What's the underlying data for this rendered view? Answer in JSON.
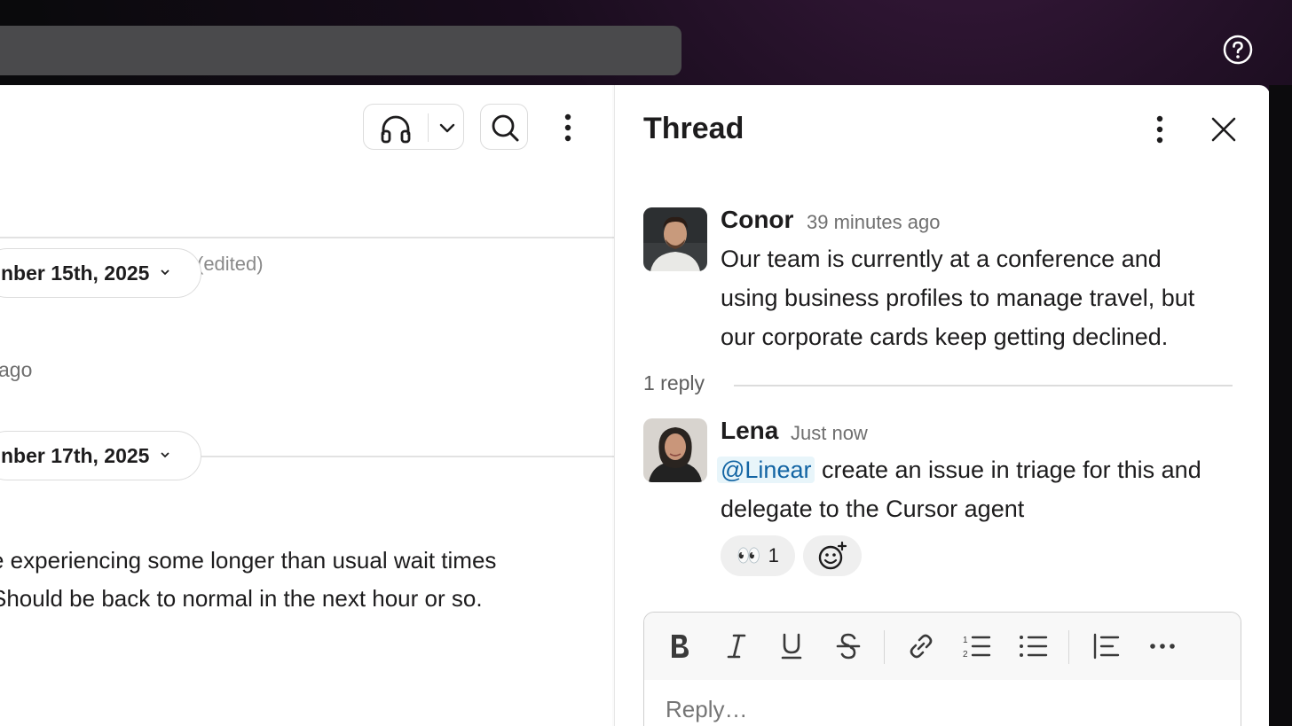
{
  "main": {
    "edited_label": "(edited)",
    "date_divider_1": "nber 15th, 2025",
    "date_divider_2": "nber 17th, 2025",
    "ago_label": "ago",
    "message_lines": [
      "e experiencing some longer than usual wait times",
      "Should be back to normal in the next hour or so."
    ]
  },
  "thread": {
    "title": "Thread",
    "parent": {
      "author": "Conor",
      "time": "39 minutes ago",
      "lines": [
        "Our team is currently at a conference and",
        "using business profiles to manage travel, but",
        "our corporate cards keep getting declined."
      ]
    },
    "reply_count": "1 reply",
    "reply": {
      "author": "Lena",
      "time": "Just now",
      "mention": "@Linear",
      "line1_rest": " create an issue in triage for this and",
      "line2": "delegate to the Cursor agent",
      "reaction_emoji": "👀",
      "reaction_count": "1"
    },
    "composer": {
      "placeholder": "Reply…",
      "tools": [
        "bold-icon",
        "italic-icon",
        "underline-icon",
        "strikethrough-icon",
        "link-icon",
        "ordered-list-icon",
        "bulleted-list-icon",
        "blockquote-icon",
        "more-formatting-icon"
      ]
    }
  },
  "colors": {
    "mention_text": "#1264a3",
    "mention_bg": "#e8f5fa",
    "window_bg": "#0a0a0c"
  }
}
